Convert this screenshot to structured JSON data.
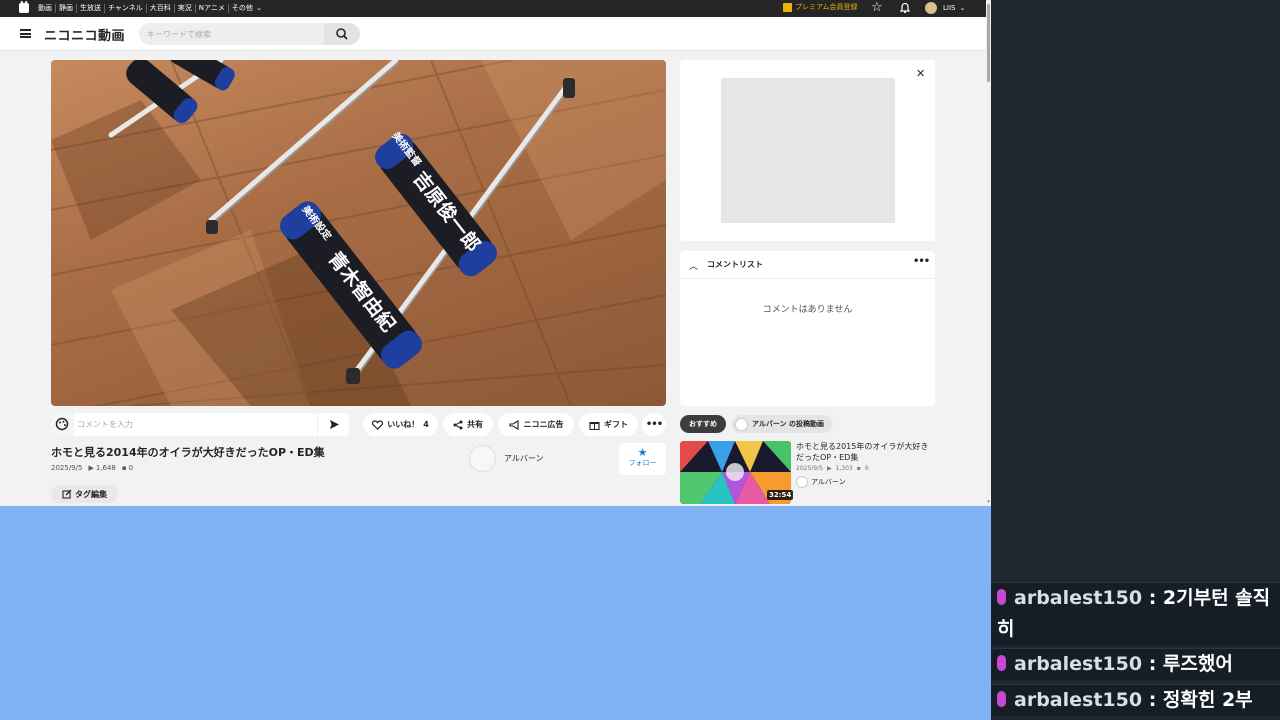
{
  "global_nav": {
    "links": [
      "動画",
      "静画",
      "生放送",
      "チャンネル",
      "大百科",
      "実況",
      "Nアニメ",
      "その他"
    ],
    "premium_label": "プレミアム会員登録",
    "user_name": "LIIS"
  },
  "header": {
    "logo": "ニコニコ動画",
    "search_placeholder": "キーワードで検索"
  },
  "comment_bar": {
    "placeholder": "コメントを入力"
  },
  "actions": {
    "like_label": "いいね！",
    "like_count": "4",
    "share_label": "共有",
    "ad_label": "ニコニ広告",
    "gift_label": "ギフト"
  },
  "video": {
    "title": "ホモと見る2014年のオイラが大好きだったOP・ED集",
    "date": "2025/9/5",
    "views": "1,648",
    "comments": "0",
    "tag_edit_label": "タグ編集",
    "owner_name": "アルバーン",
    "follow_label": "フォロー"
  },
  "comment_list": {
    "title": "コメントリスト",
    "empty_text": "コメントはありません"
  },
  "recommend": {
    "tab_active": "おすすめ",
    "tab_owner": "アルバーン の投稿動画",
    "item": {
      "title": "ホモと見る2015年のオイラが大好きだったOP・ED集",
      "date": "2025/9/5",
      "views": "1,303",
      "comments": "6",
      "owner": "アルバーン",
      "duration": "32:54"
    }
  },
  "player": {
    "sign_left": "青木智由紀",
    "sign_left_sub": "美術設定",
    "sign_right": "吉原俊一郎",
    "sign_right_sub": "美術監督"
  },
  "chat": {
    "messages": [
      {
        "user": "arbalest150",
        "text": "2기부턴 솔직히"
      },
      {
        "user": "arbalest150",
        "text": "루즈했어"
      },
      {
        "user": "arbalest150",
        "text": "정확힌 2부"
      }
    ],
    "separator": " : "
  }
}
